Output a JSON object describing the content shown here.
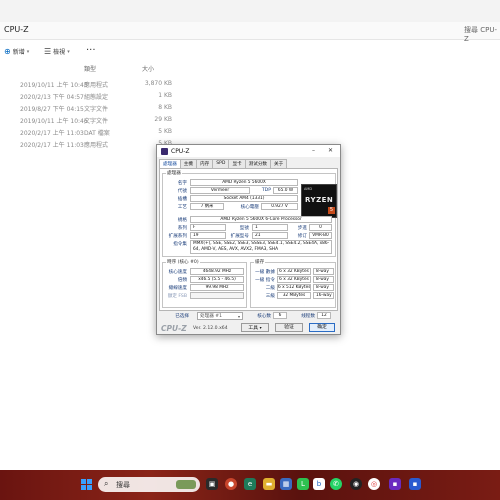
{
  "explorer": {
    "address_path": "CPU-Z",
    "search_placeholder": "搜尋 CPU-Z",
    "toolbar": {
      "new_label": "新增",
      "view_label": "檢視",
      "more_label": "···"
    },
    "columns": {
      "type": "類型",
      "size": "大小"
    },
    "rows": [
      {
        "date": "2019/10/11 上午 10:45",
        "type": "應用程式",
        "size": "3,870 KB"
      },
      {
        "date": "2020/2/13 下午 04:57",
        "type": "組態設定",
        "size": "1 KB"
      },
      {
        "date": "2019/8/27 下午 04:15",
        "type": "文字文件",
        "size": "8 KB"
      },
      {
        "date": "2019/10/11 上午 10:46",
        "type": "文字文件",
        "size": "29 KB"
      },
      {
        "date": "2020/2/17 上午 11:03",
        "type": "DAT 檔案",
        "size": "5 KB"
      },
      {
        "date": "2020/2/17 上午 11:03",
        "type": "應用程式",
        "size": "5 KB"
      }
    ]
  },
  "cpuz": {
    "title": "CPU-Z",
    "window_controls": {
      "minimize": "–",
      "close": "✕"
    },
    "tabs": [
      "處理器",
      "主機",
      "内存",
      "SPD",
      "显卡",
      "测试分数",
      "关于"
    ],
    "processor_group": "處理器",
    "labels": {
      "name": "名字",
      "codename": "代號",
      "package": "插槽",
      "technology": "工艺",
      "voltage": "核心電壓",
      "specification": "規格",
      "family": "系列",
      "model": "型號",
      "stepping": "步進",
      "ext_family": "扩展系列",
      "ext_model": "扩展型号",
      "revision": "修订",
      "instructions": "指令集",
      "tdp": "TDP"
    },
    "values": {
      "name": "AMD Ryzen 5 5600X",
      "codename": "Vermeer",
      "tdp": "65.0 W",
      "package": "Socket AM4 (1331)",
      "technology": "7 纳米",
      "voltage": "0.927 V",
      "specification": "AMD Ryzen 5 5600X 6-Core Processor",
      "family": "F",
      "model": "1",
      "stepping": "0",
      "ext_family": "19",
      "ext_model": "21",
      "revision": "VMR-B0",
      "instructions": "MMX(+), SSE, SSE2, SSE3, SSSE3, SSE4.1, SSE4.2, SSE4A, x86-64, AMD-V, AES, AVX, AVX2, FMA3, SHA"
    },
    "logo": {
      "brand_top": "AMD",
      "word": "RYZEN",
      "tier": "5"
    },
    "clocks_group": "時序 (核心 #0)",
    "clocks_labels": {
      "core_speed": "核心速度",
      "multiplier": "倍頻",
      "bus_speed": "總線速度",
      "rated_fsb": "額定 FSB"
    },
    "clocks_values": {
      "core_speed": "4648.92 MHz",
      "multiplier": "x46.5 (5.5 - 46.5)",
      "bus_speed": "99.98 MHz",
      "rated_fsb": ""
    },
    "cache_group": "緩存",
    "cache_rows": [
      {
        "label": "一級 數據",
        "size": "6 x 32 KBytes",
        "way": "8-way"
      },
      {
        "label": "一級 指令",
        "size": "6 x 32 KBytes",
        "way": "8-way"
      },
      {
        "label": "二級",
        "size": "6 x 512 KBytes",
        "way": "8-way"
      },
      {
        "label": "三級",
        "size": "32 MBytes",
        "way": "16-way"
      }
    ],
    "selection_label": "已选择",
    "selection_value": "处理器 #1",
    "cores_label": "核心数",
    "cores_value": "6",
    "threads_label": "线程数",
    "threads_value": "12",
    "brand": "CPU-Z",
    "version": "Ver. 2.12.0.x64",
    "buttons": {
      "tools": "工具",
      "validate": "验证",
      "ok": "确定"
    }
  },
  "taskbar": {
    "search_placeholder": "搜尋",
    "colors": {
      "start": "#3aa0ff",
      "accent": "#8a2418"
    }
  }
}
